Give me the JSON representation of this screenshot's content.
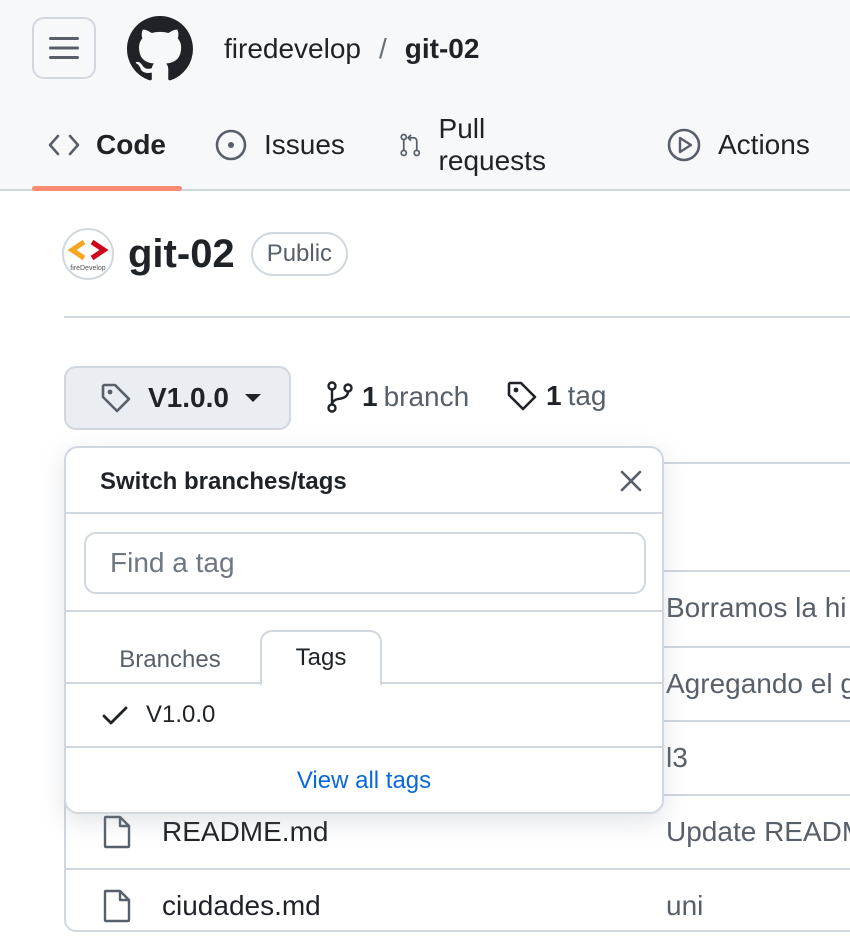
{
  "header": {
    "owner": "firedevelop",
    "separator": "/",
    "repo": "git-02",
    "tabs": [
      {
        "label": "Code",
        "icon": "code-icon",
        "active": true
      },
      {
        "label": "Issues",
        "icon": "issue-opened-icon"
      },
      {
        "label": "Pull requests",
        "icon": "git-pull-request-icon"
      },
      {
        "label": "Actions",
        "icon": "play-icon"
      }
    ]
  },
  "repo": {
    "name": "git-02",
    "visibility": "Public",
    "avatar_text": "fireDevelop"
  },
  "toolbar": {
    "current_ref": "V1.0.0",
    "branch_count": "1",
    "branch_label": "branch",
    "tag_count": "1",
    "tag_label": "tag"
  },
  "dropdown": {
    "title": "Switch branches/tags",
    "filter_placeholder": "Find a tag",
    "tabs": [
      "Branches",
      "Tags"
    ],
    "active_tab": "Tags",
    "items": [
      {
        "label": "V1.0.0",
        "selected": true
      }
    ],
    "footer_link": "View all tags"
  },
  "files": [
    {
      "name": "",
      "message": "Borramos la hi"
    },
    {
      "name": "",
      "message": "Agregando el g"
    },
    {
      "name": "",
      "message": "l3"
    },
    {
      "name": "README.md",
      "message": "Update READM"
    },
    {
      "name": "ciudades.md",
      "message": "uni"
    }
  ],
  "colors": {
    "accent_underline": "#fd8c73",
    "link": "#0969da",
    "border": "#d0d7de"
  }
}
